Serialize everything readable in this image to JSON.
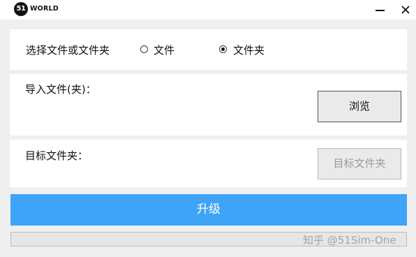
{
  "titlebar": {
    "logo_badge": "51",
    "logo_word": "WORLD",
    "minimize_icon": "minimize-icon",
    "close_icon": "close-icon"
  },
  "source_select": {
    "label": "选择文件或文件夹",
    "options": [
      {
        "label": "文件",
        "checked": false
      },
      {
        "label": "文件夹",
        "checked": true
      }
    ]
  },
  "import_section": {
    "label": "导入文件(夹)：",
    "browse_button": "浏览"
  },
  "target_section": {
    "label": "目标文件夹：",
    "target_button": "目标文件夹"
  },
  "upgrade_button": "升级",
  "progress": {
    "value": 0
  },
  "watermark": "知乎 @51Sim-One",
  "colors": {
    "accent": "#3fa4f7",
    "background": "#efefef",
    "panel": "#ffffff"
  }
}
